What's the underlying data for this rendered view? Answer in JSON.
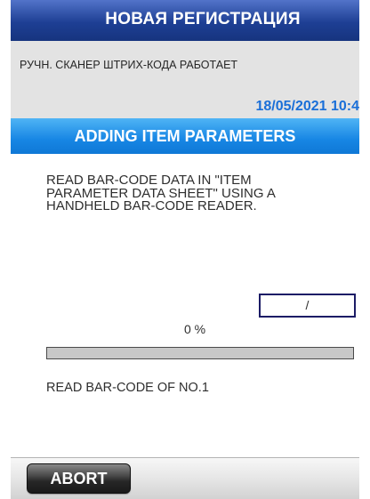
{
  "header": {
    "title": "НОВАЯ РЕГИСТРАЦИЯ"
  },
  "status": {
    "message": "РУЧН. СКАНЕР ШТРИХ-КОДА РАБОТАЕТ",
    "datetime": "18/05/2021 10:4"
  },
  "section": {
    "title": "ADDING ITEM PARAMETERS"
  },
  "instructions": {
    "lines": [
      "READ BAR-CODE DATA IN \"ITEM",
      "PARAMETER DATA SHEET\" USING A",
      "HANDHELD BAR-CODE READER."
    ]
  },
  "counter": {
    "value": "/"
  },
  "progress": {
    "label": "0 %",
    "percent": 0
  },
  "step": {
    "text": "READ BAR-CODE OF NO.1"
  },
  "footer": {
    "abort_label": "ABORT"
  },
  "theme": {
    "title_bar": "#1e3f94",
    "status_panel": "#e3e3e3",
    "datetime": "#1a6fd8",
    "section_bar": "#1786e4",
    "progress_track": "#c8c8c8",
    "progress_fill": "#2a7de1",
    "counter_border": "#1c1c66",
    "abort_button": "#262626"
  }
}
